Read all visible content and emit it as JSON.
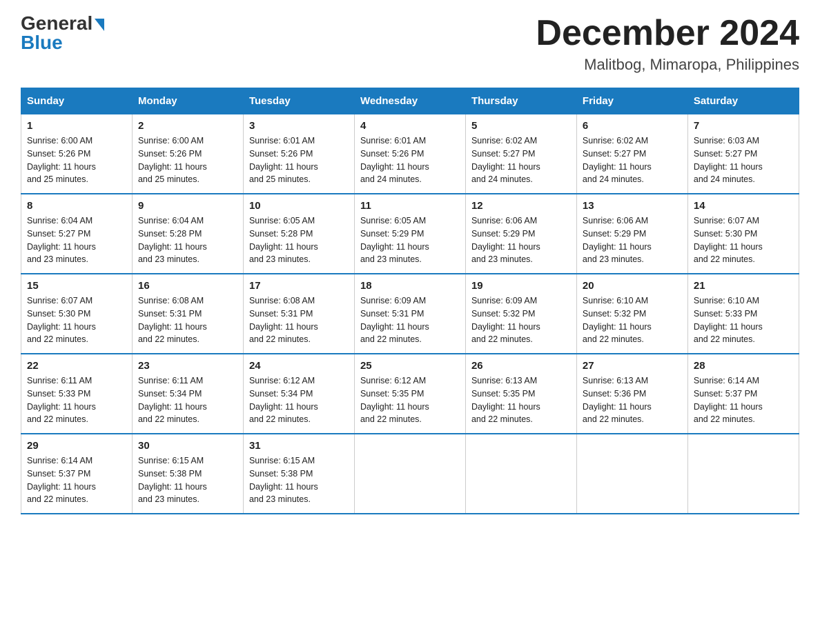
{
  "logo": {
    "general": "General",
    "blue": "Blue",
    "arrow": "▶"
  },
  "title": "December 2024",
  "subtitle": "Malitbog, Mimaropa, Philippines",
  "headers": [
    "Sunday",
    "Monday",
    "Tuesday",
    "Wednesday",
    "Thursday",
    "Friday",
    "Saturday"
  ],
  "weeks": [
    [
      {
        "day": "1",
        "sunrise": "6:00 AM",
        "sunset": "5:26 PM",
        "daylight": "11 hours and 25 minutes."
      },
      {
        "day": "2",
        "sunrise": "6:00 AM",
        "sunset": "5:26 PM",
        "daylight": "11 hours and 25 minutes."
      },
      {
        "day": "3",
        "sunrise": "6:01 AM",
        "sunset": "5:26 PM",
        "daylight": "11 hours and 25 minutes."
      },
      {
        "day": "4",
        "sunrise": "6:01 AM",
        "sunset": "5:26 PM",
        "daylight": "11 hours and 24 minutes."
      },
      {
        "day": "5",
        "sunrise": "6:02 AM",
        "sunset": "5:27 PM",
        "daylight": "11 hours and 24 minutes."
      },
      {
        "day": "6",
        "sunrise": "6:02 AM",
        "sunset": "5:27 PM",
        "daylight": "11 hours and 24 minutes."
      },
      {
        "day": "7",
        "sunrise": "6:03 AM",
        "sunset": "5:27 PM",
        "daylight": "11 hours and 24 minutes."
      }
    ],
    [
      {
        "day": "8",
        "sunrise": "6:04 AM",
        "sunset": "5:27 PM",
        "daylight": "11 hours and 23 minutes."
      },
      {
        "day": "9",
        "sunrise": "6:04 AM",
        "sunset": "5:28 PM",
        "daylight": "11 hours and 23 minutes."
      },
      {
        "day": "10",
        "sunrise": "6:05 AM",
        "sunset": "5:28 PM",
        "daylight": "11 hours and 23 minutes."
      },
      {
        "day": "11",
        "sunrise": "6:05 AM",
        "sunset": "5:29 PM",
        "daylight": "11 hours and 23 minutes."
      },
      {
        "day": "12",
        "sunrise": "6:06 AM",
        "sunset": "5:29 PM",
        "daylight": "11 hours and 23 minutes."
      },
      {
        "day": "13",
        "sunrise": "6:06 AM",
        "sunset": "5:29 PM",
        "daylight": "11 hours and 23 minutes."
      },
      {
        "day": "14",
        "sunrise": "6:07 AM",
        "sunset": "5:30 PM",
        "daylight": "11 hours and 22 minutes."
      }
    ],
    [
      {
        "day": "15",
        "sunrise": "6:07 AM",
        "sunset": "5:30 PM",
        "daylight": "11 hours and 22 minutes."
      },
      {
        "day": "16",
        "sunrise": "6:08 AM",
        "sunset": "5:31 PM",
        "daylight": "11 hours and 22 minutes."
      },
      {
        "day": "17",
        "sunrise": "6:08 AM",
        "sunset": "5:31 PM",
        "daylight": "11 hours and 22 minutes."
      },
      {
        "day": "18",
        "sunrise": "6:09 AM",
        "sunset": "5:31 PM",
        "daylight": "11 hours and 22 minutes."
      },
      {
        "day": "19",
        "sunrise": "6:09 AM",
        "sunset": "5:32 PM",
        "daylight": "11 hours and 22 minutes."
      },
      {
        "day": "20",
        "sunrise": "6:10 AM",
        "sunset": "5:32 PM",
        "daylight": "11 hours and 22 minutes."
      },
      {
        "day": "21",
        "sunrise": "6:10 AM",
        "sunset": "5:33 PM",
        "daylight": "11 hours and 22 minutes."
      }
    ],
    [
      {
        "day": "22",
        "sunrise": "6:11 AM",
        "sunset": "5:33 PM",
        "daylight": "11 hours and 22 minutes."
      },
      {
        "day": "23",
        "sunrise": "6:11 AM",
        "sunset": "5:34 PM",
        "daylight": "11 hours and 22 minutes."
      },
      {
        "day": "24",
        "sunrise": "6:12 AM",
        "sunset": "5:34 PM",
        "daylight": "11 hours and 22 minutes."
      },
      {
        "day": "25",
        "sunrise": "6:12 AM",
        "sunset": "5:35 PM",
        "daylight": "11 hours and 22 minutes."
      },
      {
        "day": "26",
        "sunrise": "6:13 AM",
        "sunset": "5:35 PM",
        "daylight": "11 hours and 22 minutes."
      },
      {
        "day": "27",
        "sunrise": "6:13 AM",
        "sunset": "5:36 PM",
        "daylight": "11 hours and 22 minutes."
      },
      {
        "day": "28",
        "sunrise": "6:14 AM",
        "sunset": "5:37 PM",
        "daylight": "11 hours and 22 minutes."
      }
    ],
    [
      {
        "day": "29",
        "sunrise": "6:14 AM",
        "sunset": "5:37 PM",
        "daylight": "11 hours and 22 minutes."
      },
      {
        "day": "30",
        "sunrise": "6:15 AM",
        "sunset": "5:38 PM",
        "daylight": "11 hours and 23 minutes."
      },
      {
        "day": "31",
        "sunrise": "6:15 AM",
        "sunset": "5:38 PM",
        "daylight": "11 hours and 23 minutes."
      },
      null,
      null,
      null,
      null
    ]
  ],
  "labels": {
    "sunrise": "Sunrise:",
    "sunset": "Sunset:",
    "daylight": "Daylight:"
  }
}
